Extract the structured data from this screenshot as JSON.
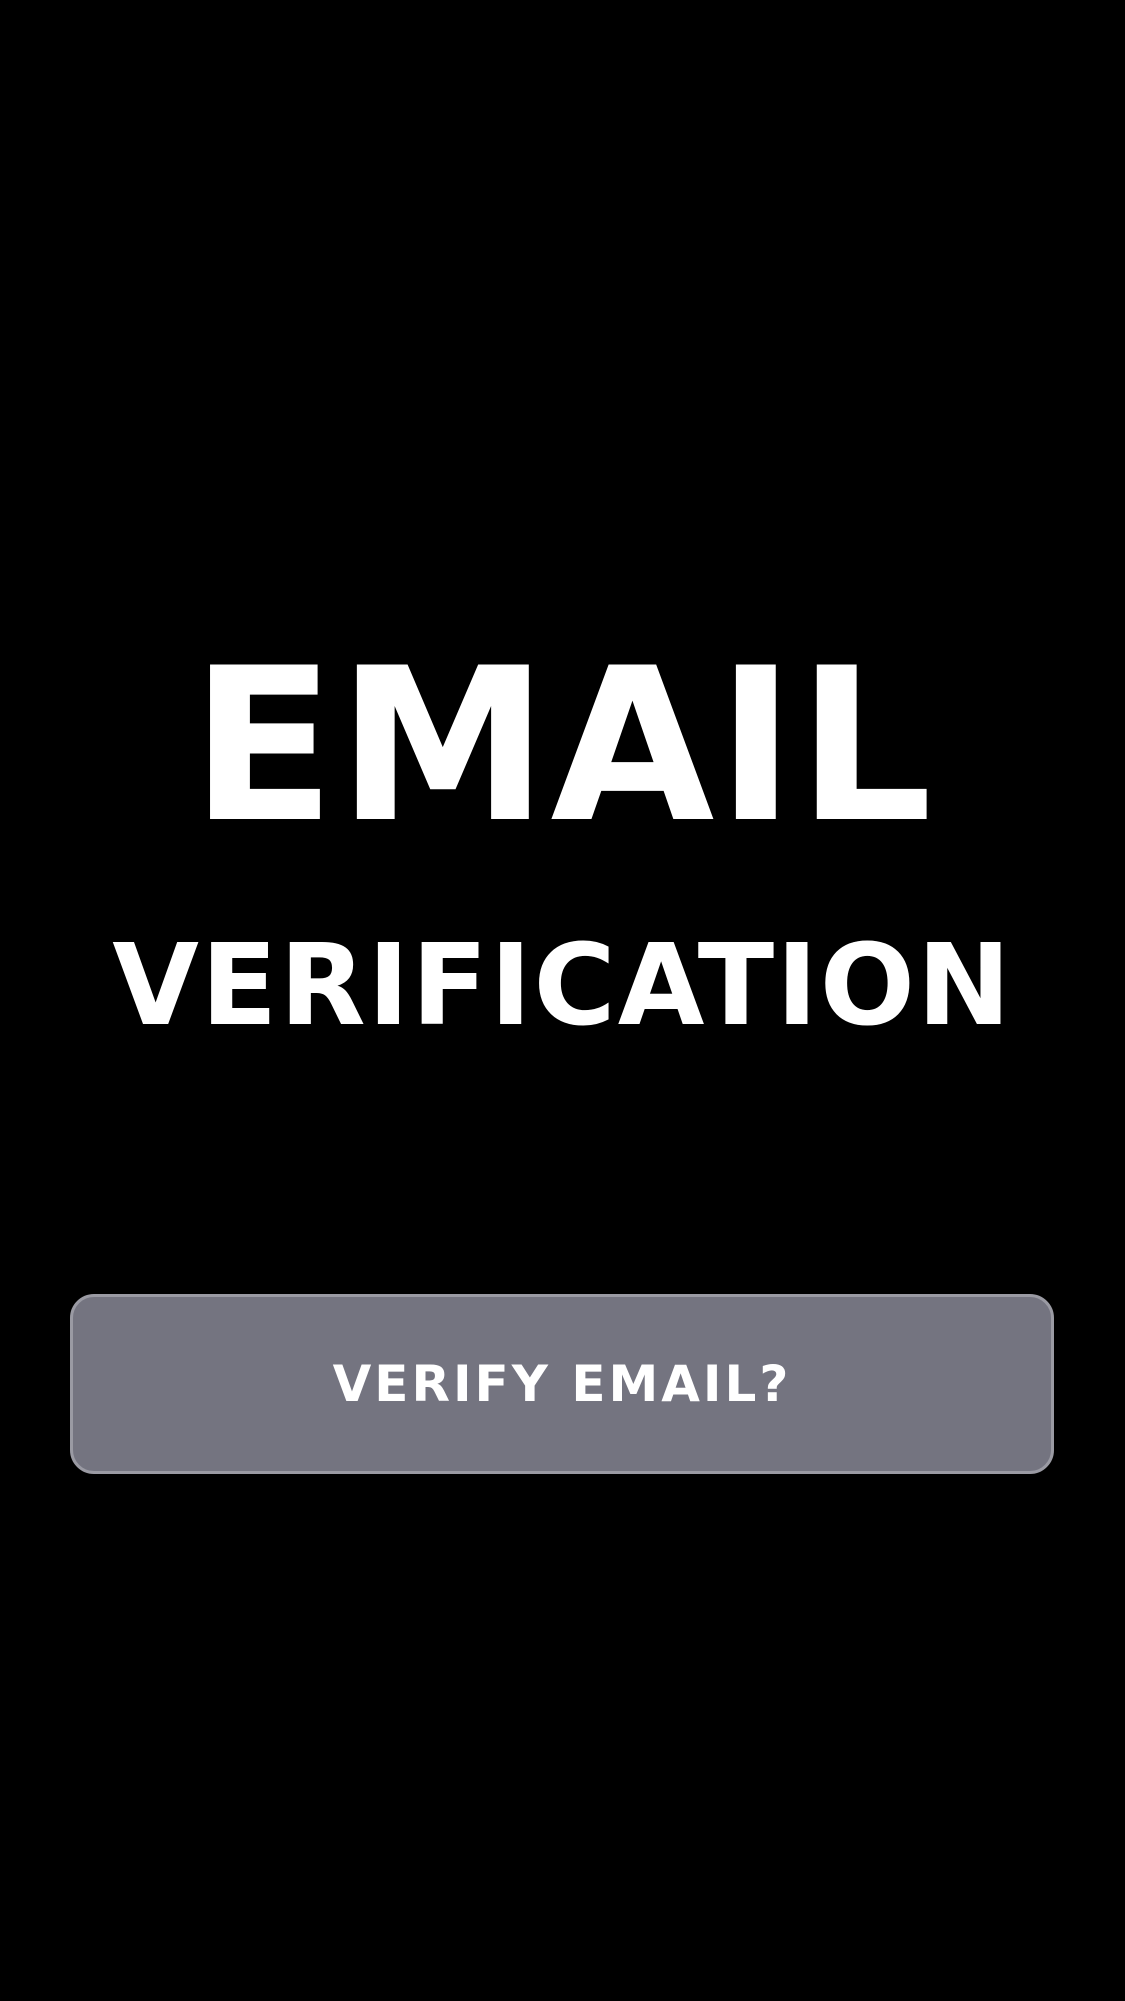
{
  "header": {
    "title_line_1": "EMAIL",
    "title_line_2": "VERIFICATION"
  },
  "actions": {
    "verify_button_label": "VERIFY EMAIL?"
  },
  "colors": {
    "background": "#000000",
    "title_text": "#ffffff",
    "button_fill": "#747480",
    "button_border": "#9a9aa3",
    "button_text": "#ffffff"
  }
}
